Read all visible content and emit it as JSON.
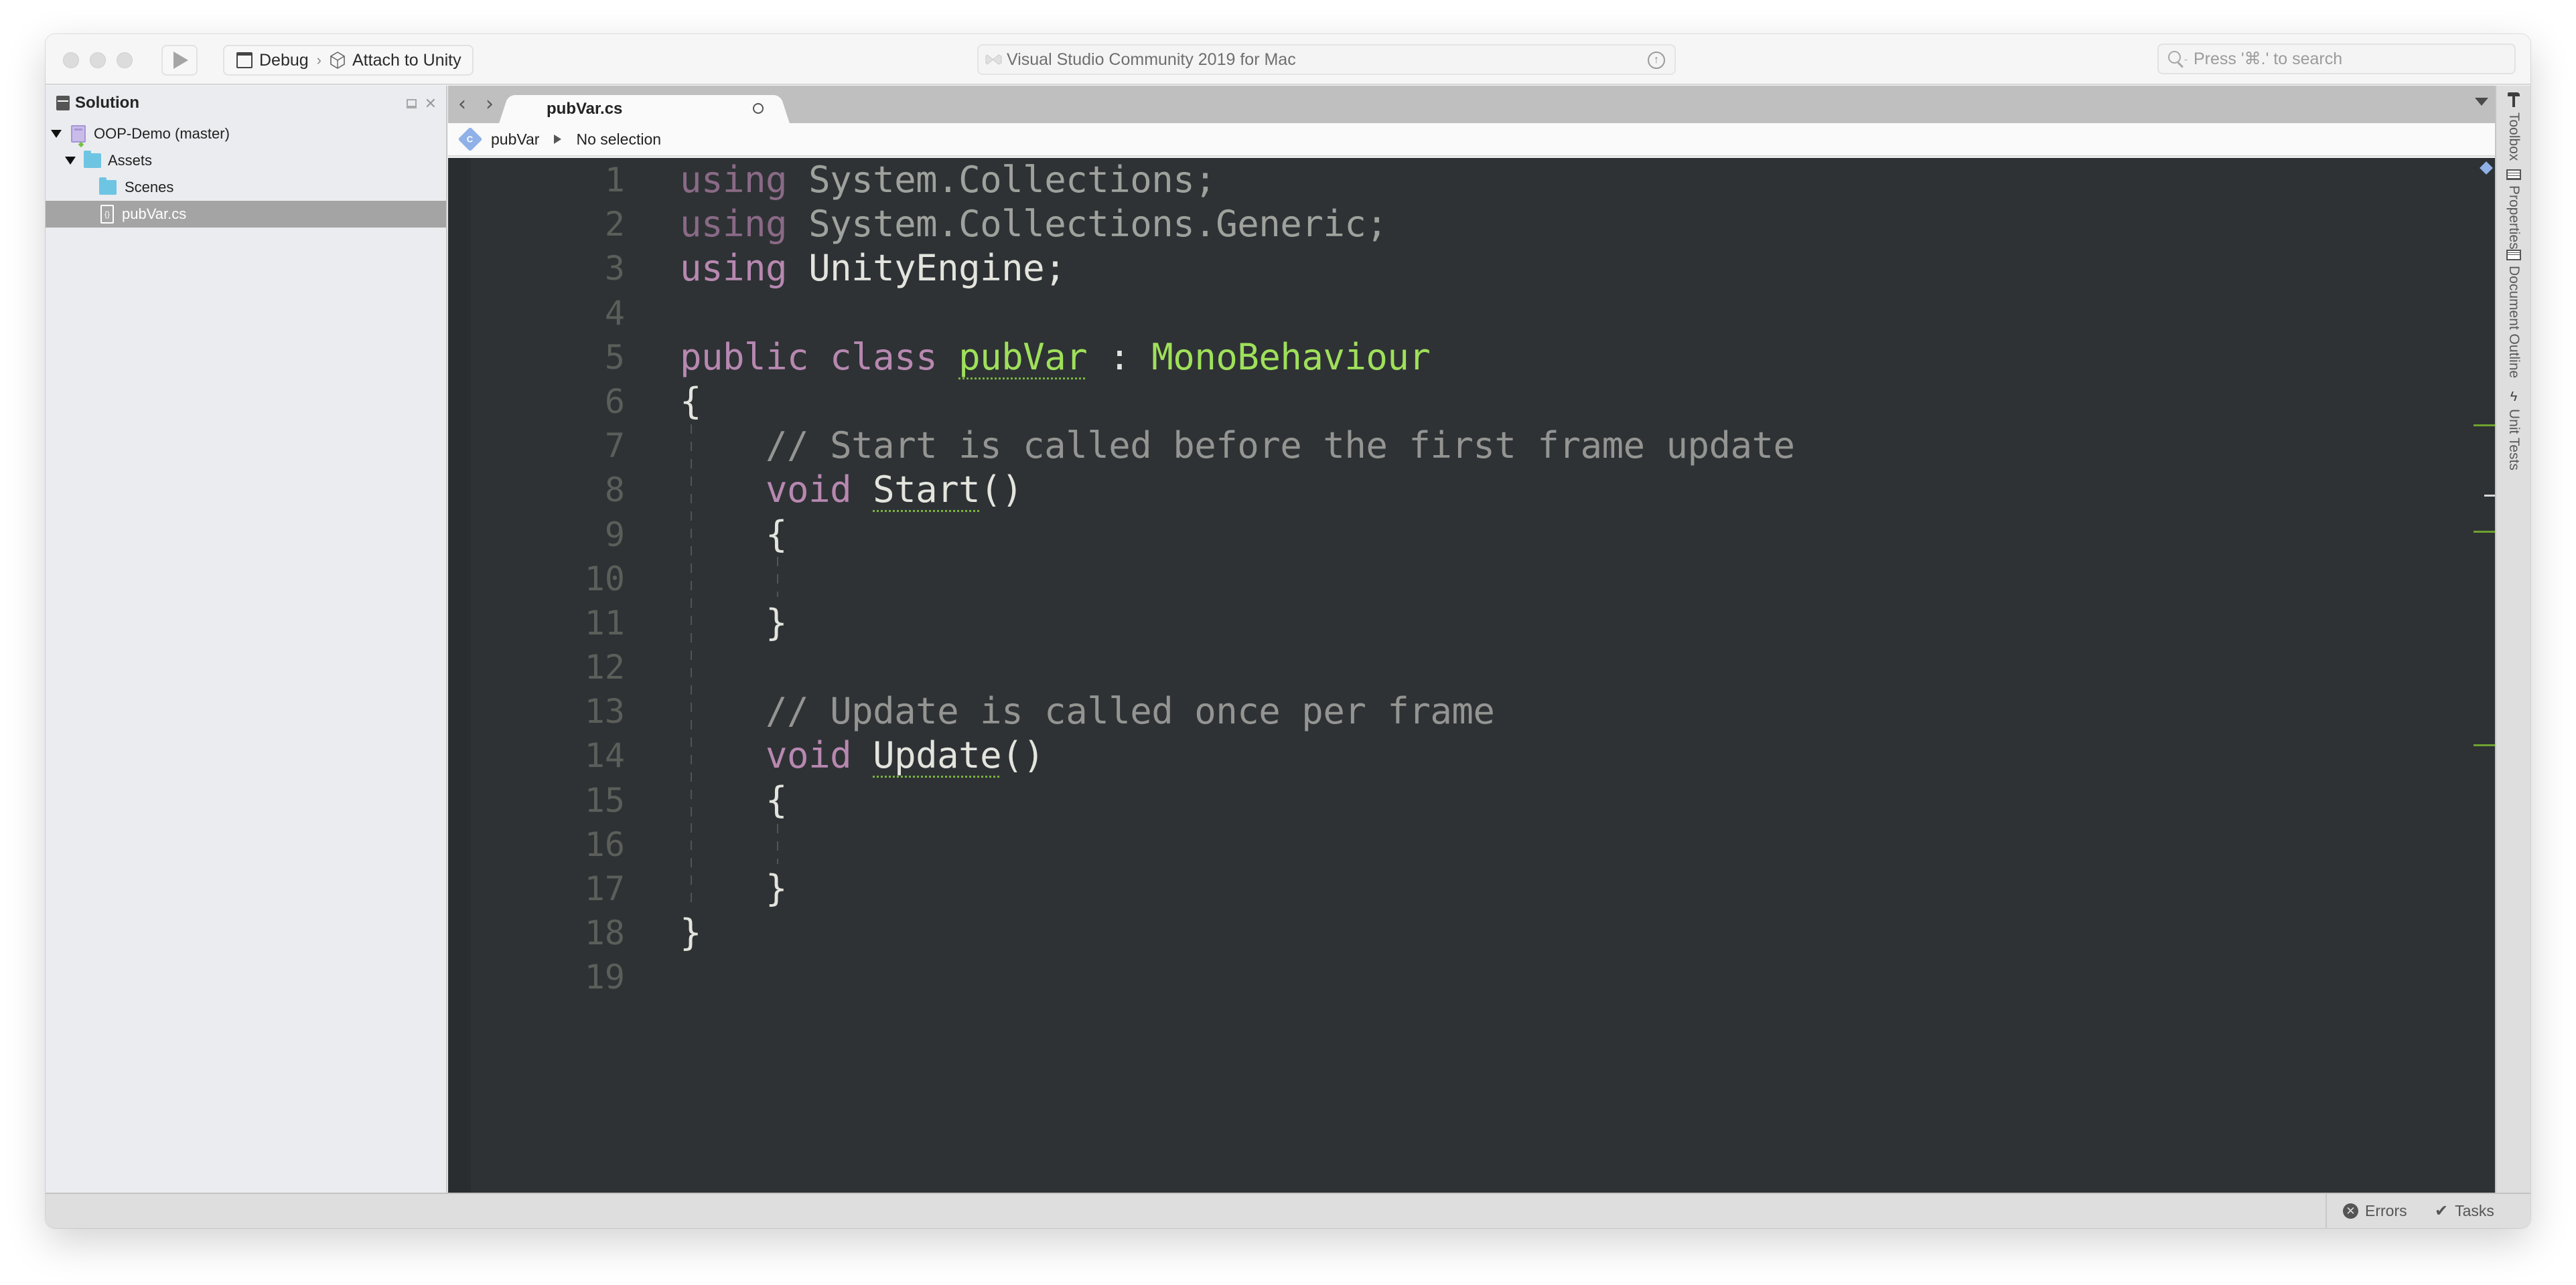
{
  "toolbar": {
    "config": "Debug",
    "target": "Attach to Unity",
    "title": "Visual Studio Community 2019 for Mac",
    "search_placeholder": "Press '⌘.' to search"
  },
  "solution_pad": {
    "title": "Solution",
    "tree": [
      {
        "label": "OOP-Demo (master)",
        "type": "project",
        "expanded": true
      },
      {
        "label": "Assets",
        "type": "folder",
        "expanded": true
      },
      {
        "label": "Scenes",
        "type": "folder",
        "expanded": false
      },
      {
        "label": "pubVar.cs",
        "type": "csharp-file",
        "selected": true
      }
    ]
  },
  "editor": {
    "tab_label": "pubVar.cs",
    "breadcrumb": {
      "class_name": "pubVar",
      "class_icon_letter": "C",
      "member": "No selection"
    },
    "line_numbers": [
      "1",
      "2",
      "3",
      "4",
      "5",
      "6",
      "7",
      "8",
      "9",
      "10",
      "11",
      "12",
      "13",
      "14",
      "15",
      "16",
      "17",
      "18",
      "19"
    ],
    "code": {
      "l1_kw": "using",
      "l1_ns": " System.Collections;",
      "l2_kw": "using",
      "l2_ns": " System.Collections.Generic;",
      "l3_kw": "using",
      "l3_ns": " UnityEngine;",
      "l5_kw1": "public",
      "l5_kw2": "class",
      "l5_name": "pubVar",
      "l5_colon": " : ",
      "l5_base": "MonoBehaviour",
      "l6": "{",
      "l7": "    // Start is called before the first frame update",
      "l8_kw": "void",
      "l8_name": "Start",
      "l8_rest": "()",
      "l9": "    {",
      "l11": "    }",
      "l13": "    // Update is called once per frame",
      "l14_kw": "void",
      "l14_name": "Update",
      "l14_rest": "()",
      "l15": "    {",
      "l17": "    }",
      "l18": "}"
    }
  },
  "right_dock": {
    "items": [
      "Toolbox",
      "Properties",
      "Document Outline",
      "Unit Tests"
    ]
  },
  "statusbar": {
    "errors_label": "Errors",
    "tasks_label": "Tasks"
  },
  "theme": {
    "editor_bg": "#2e3235",
    "keyword": "#b788b0",
    "type": "#9fe05a",
    "comment": "#949592",
    "selection": "#a4a4a4"
  }
}
